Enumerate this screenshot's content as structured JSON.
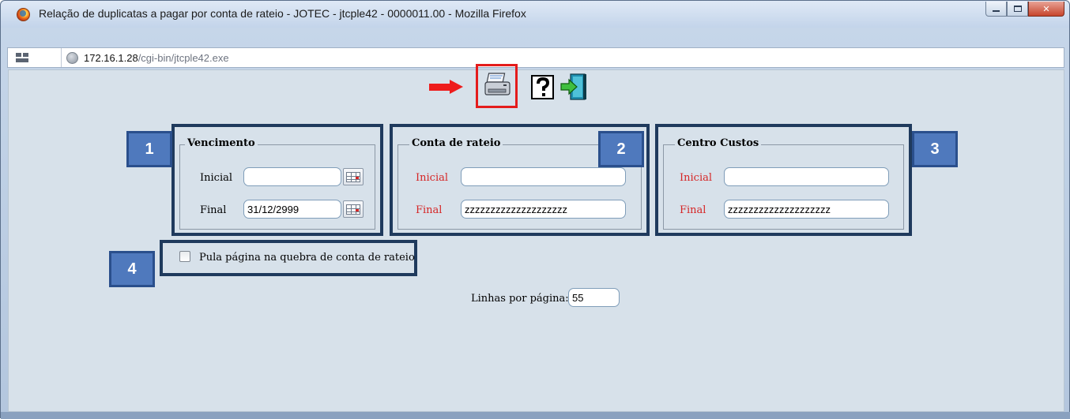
{
  "window": {
    "title": "Relação de duplicatas a pagar por conta de rateio - JOTEC - jtcple42 - 0000011.00 - Mozilla Firefox"
  },
  "addressbar": {
    "host": "172.16.1.28",
    "path": "/cgi-bin/jtcple42.exe"
  },
  "toolbar": {
    "print_icon": "printer-icon",
    "help_icon": "help-icon",
    "exit_icon": "exit-door-icon",
    "highlight_color": "#e41c1c"
  },
  "panels": {
    "vencimento": {
      "badge": "1",
      "legend": "Vencimento",
      "inicial_label": "Inicial",
      "inicial_value": "",
      "final_label": "Final",
      "final_value": "31/12/2999"
    },
    "conta_rateio": {
      "badge": "2",
      "legend": "Conta de rateio",
      "inicial_label": "Inicial",
      "inicial_value": "",
      "final_label": "Final",
      "final_value": "zzzzzzzzzzzzzzzzzzzz"
    },
    "centro_custos": {
      "badge": "3",
      "legend": "Centro Custos",
      "inicial_label": "Inicial",
      "inicial_value": "",
      "final_label": "Final",
      "final_value": "zzzzzzzzzzzzzzzzzzzz"
    }
  },
  "options": {
    "badge": "4",
    "pula_pagina_label": "Pula página na quebra de conta de rateio",
    "pula_pagina_checked": false,
    "linhas_label": "Linhas por página:",
    "linhas_value": "55"
  },
  "colors": {
    "badge_bg": "#4f79bd",
    "outline": "#1f3a5d",
    "required_label": "#d62525",
    "page_bg": "#d7e1ea"
  }
}
